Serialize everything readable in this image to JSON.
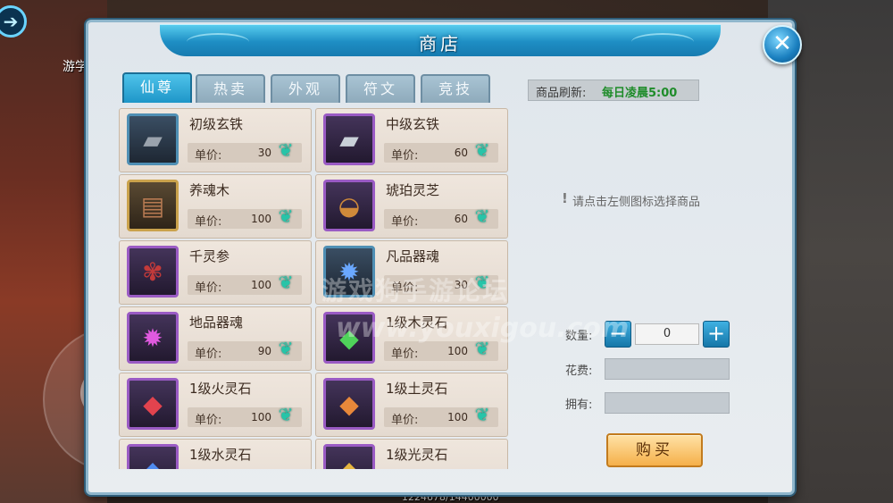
{
  "hud": {
    "player_name": "游学",
    "status_numbers": "1224678/14400000"
  },
  "shop": {
    "title": "商店",
    "tabs": [
      {
        "label": "仙尊",
        "active": true
      },
      {
        "label": "热卖",
        "active": false
      },
      {
        "label": "外观",
        "active": false
      },
      {
        "label": "符文",
        "active": false
      },
      {
        "label": "竞技",
        "active": false
      }
    ],
    "price_label": "单价:",
    "currency_icon": "jade-icon",
    "items": [
      {
        "name": "初级玄铁",
        "price": "30",
        "icon": "iron-ingot-icon",
        "quality": "blue"
      },
      {
        "name": "中级玄铁",
        "price": "60",
        "icon": "iron-ingot-icon",
        "quality": "purple"
      },
      {
        "name": "养魂木",
        "price": "100",
        "icon": "wood-icon",
        "quality": "gold"
      },
      {
        "name": "琥珀灵芝",
        "price": "60",
        "icon": "lingzhi-icon",
        "quality": "purple"
      },
      {
        "name": "千灵参",
        "price": "100",
        "icon": "ginseng-icon",
        "quality": "purple"
      },
      {
        "name": "凡品器魂",
        "price": "30",
        "icon": "blue-flame-icon",
        "quality": "blue"
      },
      {
        "name": "地品器魂",
        "price": "90",
        "icon": "purple-flame-icon",
        "quality": "purple"
      },
      {
        "name": "1级木灵石",
        "price": "100",
        "icon": "green-gem-icon",
        "quality": "purple"
      },
      {
        "name": "1级火灵石",
        "price": "100",
        "icon": "red-gem-icon",
        "quality": "purple"
      },
      {
        "name": "1级土灵石",
        "price": "100",
        "icon": "orange-gem-icon",
        "quality": "purple"
      },
      {
        "name": "1级水灵石",
        "price": "",
        "icon": "blue-gem-icon",
        "quality": "purple"
      },
      {
        "name": "1级光灵石",
        "price": "",
        "icon": "yellow-gem-icon",
        "quality": "purple"
      }
    ],
    "detail": {
      "refresh_label": "商品刷新:",
      "refresh_value": "每日凌晨5:00",
      "hint": "请点击左侧图标选择商品",
      "quantity_label": "数量:",
      "quantity_value": "0",
      "cost_label": "花费:",
      "owned_label": "拥有:",
      "buy_label": "购买"
    },
    "watermark_line1": "游戏狗手游论坛",
    "watermark_line2": "www.youxigou.com"
  }
}
